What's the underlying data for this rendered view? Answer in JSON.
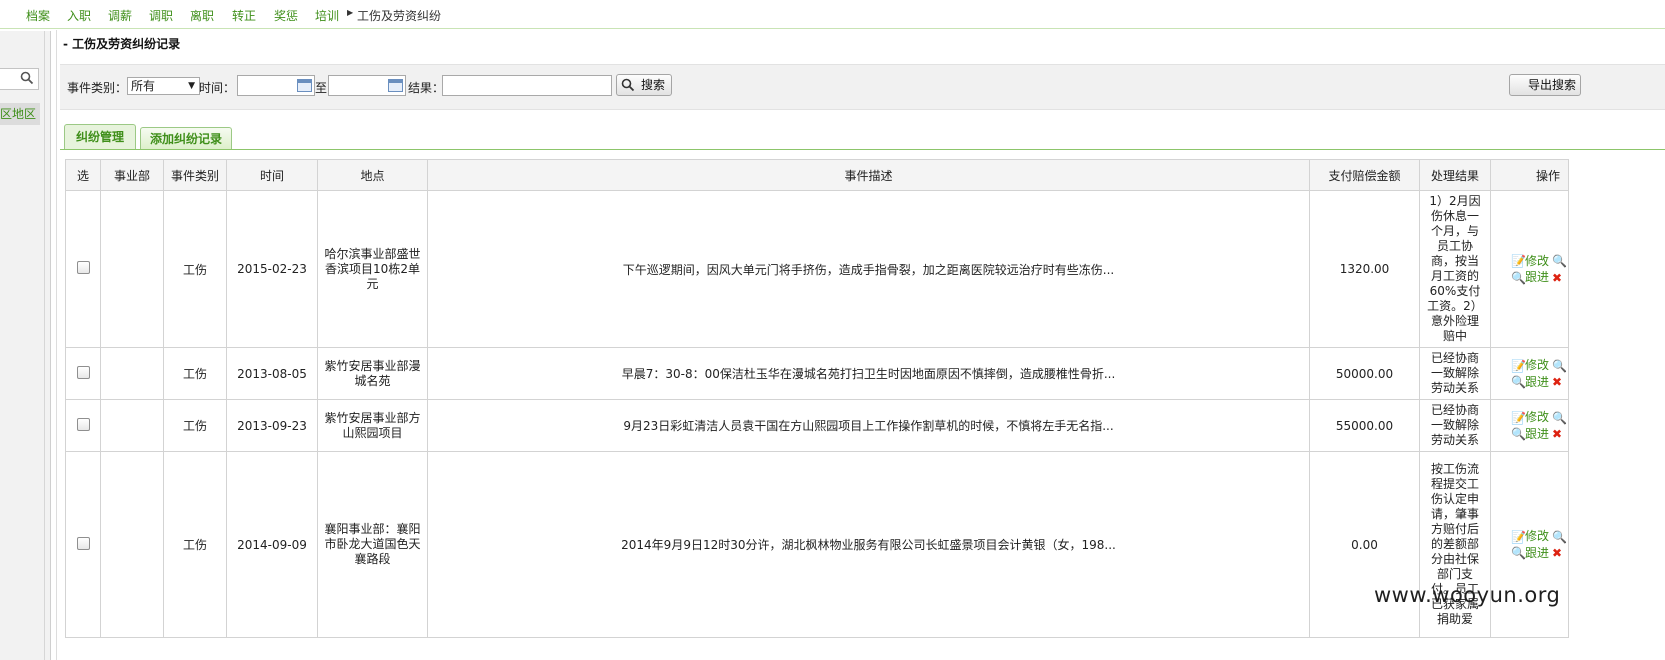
{
  "topnav": {
    "items": [
      "档案",
      "入职",
      "调薪",
      "调职",
      "离职",
      "转正",
      "奖惩",
      "培训"
    ],
    "current": "工伤及劳资纠纷"
  },
  "sidebar": {
    "region_label": "区地区"
  },
  "page": {
    "title": "- 工伤及劳资纠纷记录"
  },
  "filters": {
    "category_label": "事件类别：",
    "category_value": "所有",
    "time_label": "时间：",
    "to_label": "至",
    "result_label": "结果：",
    "search_button": "搜索",
    "export_button": "导出搜索"
  },
  "tabs": {
    "manage": "纠纷管理",
    "add": "添加纠纷记录"
  },
  "table": {
    "headers": [
      "选",
      "事业部",
      "事件类别",
      "时间",
      "地点",
      "事件描述",
      "支付赔偿金额",
      "处理结果",
      "操作"
    ],
    "rows": [
      {
        "dept": "",
        "category": "工伤",
        "date": "2015-02-23",
        "location": "哈尔滨事业部盛世香滨项目10栋2单元",
        "description": "下午巡逻期间，因风大单元门将手挤伤，造成手指骨裂，加之距离医院较远治疗时有些冻伤...",
        "amount": "1320.00",
        "result": "1）2月因伤休息一个月，与员工协商，按当月工资的60%支付工资。2）意外险理赔中"
      },
      {
        "dept": "",
        "category": "工伤",
        "date": "2013-08-05",
        "location": "紫竹安居事业部漫城名苑",
        "description": "早晨7：30-8：00保洁杜玉华在漫城名苑打扫卫生时因地面原因不慎摔倒，造成腰椎性骨折...",
        "amount": "50000.00",
        "result": "已经协商一致解除劳动关系"
      },
      {
        "dept": "",
        "category": "工伤",
        "date": "2013-09-23",
        "location": "紫竹安居事业部方山熙园项目",
        "description": "9月23日彩虹清洁人员袁干国在方山熙园项目上工作操作割草机的时候，不慎将左手无名指...",
        "amount": "55000.00",
        "result": "已经协商一致解除劳动关系"
      },
      {
        "dept": "",
        "category": "工伤",
        "date": "2014-09-09",
        "location": "襄阳事业部：襄阳市卧龙大道国色天襄路段",
        "description": "2014年9月9日12时30分许，湖北枫林物业服务有限公司长虹盛景项目会计黄银（女，198...",
        "amount": "0.00",
        "result": "按工伤流程提交工伤认定申请，肇事方赔付后的差额部分由社保部门支付。员工已获家属捐助爱"
      }
    ],
    "ops": {
      "edit": "修改",
      "follow": "跟进"
    }
  },
  "watermark": "www.wooyun.org"
}
